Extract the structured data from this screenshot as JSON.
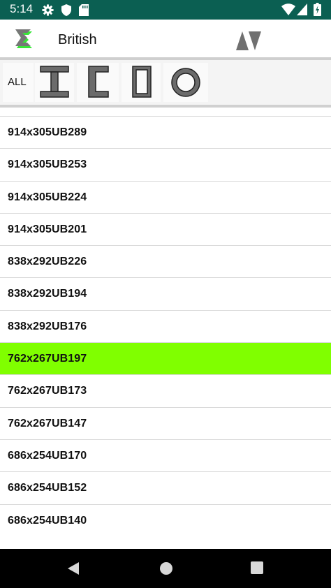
{
  "status_bar": {
    "time": "5:14",
    "icons_left": [
      "gear-icon",
      "shield-icon",
      "sd-card-icon"
    ],
    "icons_right": [
      "wifi-icon",
      "cell-signal-icon",
      "battery-icon"
    ]
  },
  "toolbar": {
    "title": "British",
    "logo_icon": "steel-section-logo-icon",
    "sort_icon": "sort-up-down-icon"
  },
  "filters": {
    "all_label": "ALL",
    "items": [
      "i-beam-icon",
      "channel-icon",
      "rectangular-hollow-icon",
      "circular-hollow-icon"
    ]
  },
  "sections": [
    "914x305UB289",
    "914x305UB253",
    "914x305UB224",
    "914x305UB201",
    "838x292UB226",
    "838x292UB194",
    "838x292UB176",
    "762x267UB197",
    "762x267UB173",
    "762x267UB147",
    "686x254UB170",
    "686x254UB152",
    "686x254UB140"
  ],
  "selected_section": "762x267UB197",
  "colors": {
    "status_bar": "#0b5f52",
    "selected_row": "#80ff00",
    "nav_bar": "#000000",
    "logo_green": "#39e639"
  },
  "nav_bar": [
    "back-icon",
    "home-icon",
    "recents-icon"
  ]
}
